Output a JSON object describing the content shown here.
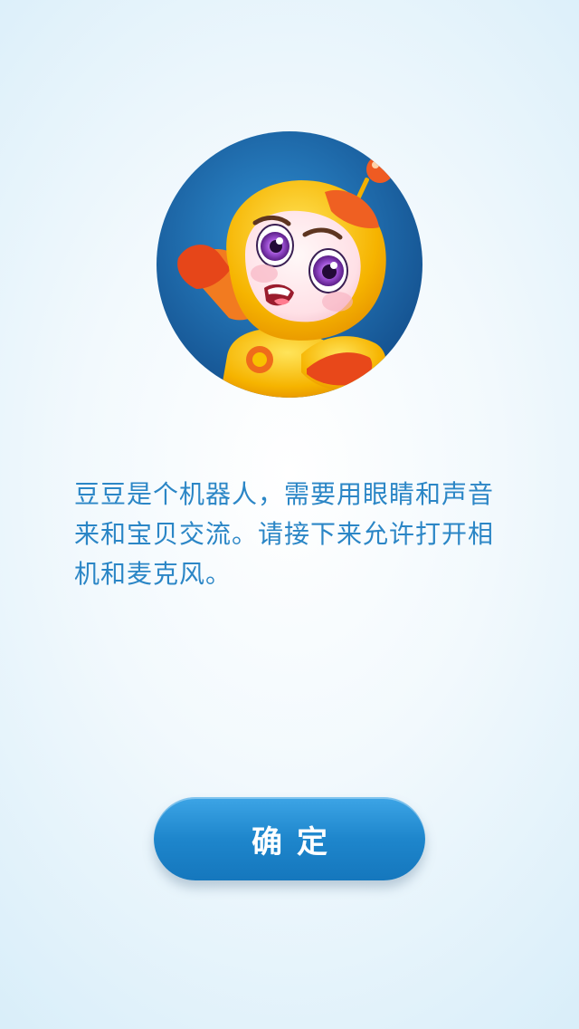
{
  "mascot": {
    "icon": "robot-mascot-icon",
    "circle_color": "#1c5f9e",
    "body_color": "#f5b800"
  },
  "message": {
    "text": "豆豆是个机器人，需要用眼睛和声音来和宝贝交流。请接下来允许打开相机和麦克风。"
  },
  "confirm": {
    "label": "确定",
    "color": "#1e86cc"
  }
}
